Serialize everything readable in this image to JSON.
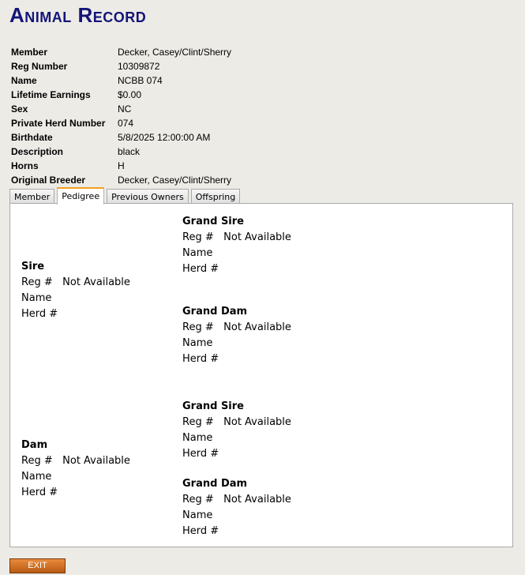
{
  "title": "Animal Record",
  "record": [
    {
      "label": "Member",
      "value": "Decker, Casey/Clint/Sherry"
    },
    {
      "label": "Reg Number",
      "value": "10309872"
    },
    {
      "label": "Name",
      "value": "NCBB 074"
    },
    {
      "label": "Lifetime Earnings",
      "value": "$0.00"
    },
    {
      "label": "Sex",
      "value": "NC"
    },
    {
      "label": "Private Herd Number",
      "value": "074"
    },
    {
      "label": "Birthdate",
      "value": "5/8/2025 12:00:00 AM"
    },
    {
      "label": "Description",
      "value": "black"
    },
    {
      "label": "Horns",
      "value": "H"
    },
    {
      "label": "Original Breeder",
      "value": "Decker, Casey/Clint/Sherry"
    }
  ],
  "tabs": [
    {
      "label": "Member",
      "active": false
    },
    {
      "label": "Pedigree",
      "active": true
    },
    {
      "label": "Previous Owners",
      "active": false
    },
    {
      "label": "Offspring",
      "active": false
    }
  ],
  "pedigree": {
    "reg_label": "Reg #",
    "name_label": "Name",
    "herd_label": "Herd #",
    "sire": {
      "title": "Sire",
      "reg": "Not Available"
    },
    "sire_grand_sire": {
      "title": "Grand Sire",
      "reg": "Not Available"
    },
    "sire_grand_dam": {
      "title": "Grand Dam",
      "reg": "Not Available"
    },
    "dam": {
      "title": "Dam",
      "reg": "Not Available"
    },
    "dam_grand_sire": {
      "title": "Grand Sire",
      "reg": "Not Available"
    },
    "dam_grand_dam": {
      "title": "Grand Dam",
      "reg": "Not Available"
    }
  },
  "exit_label": "EXIT"
}
